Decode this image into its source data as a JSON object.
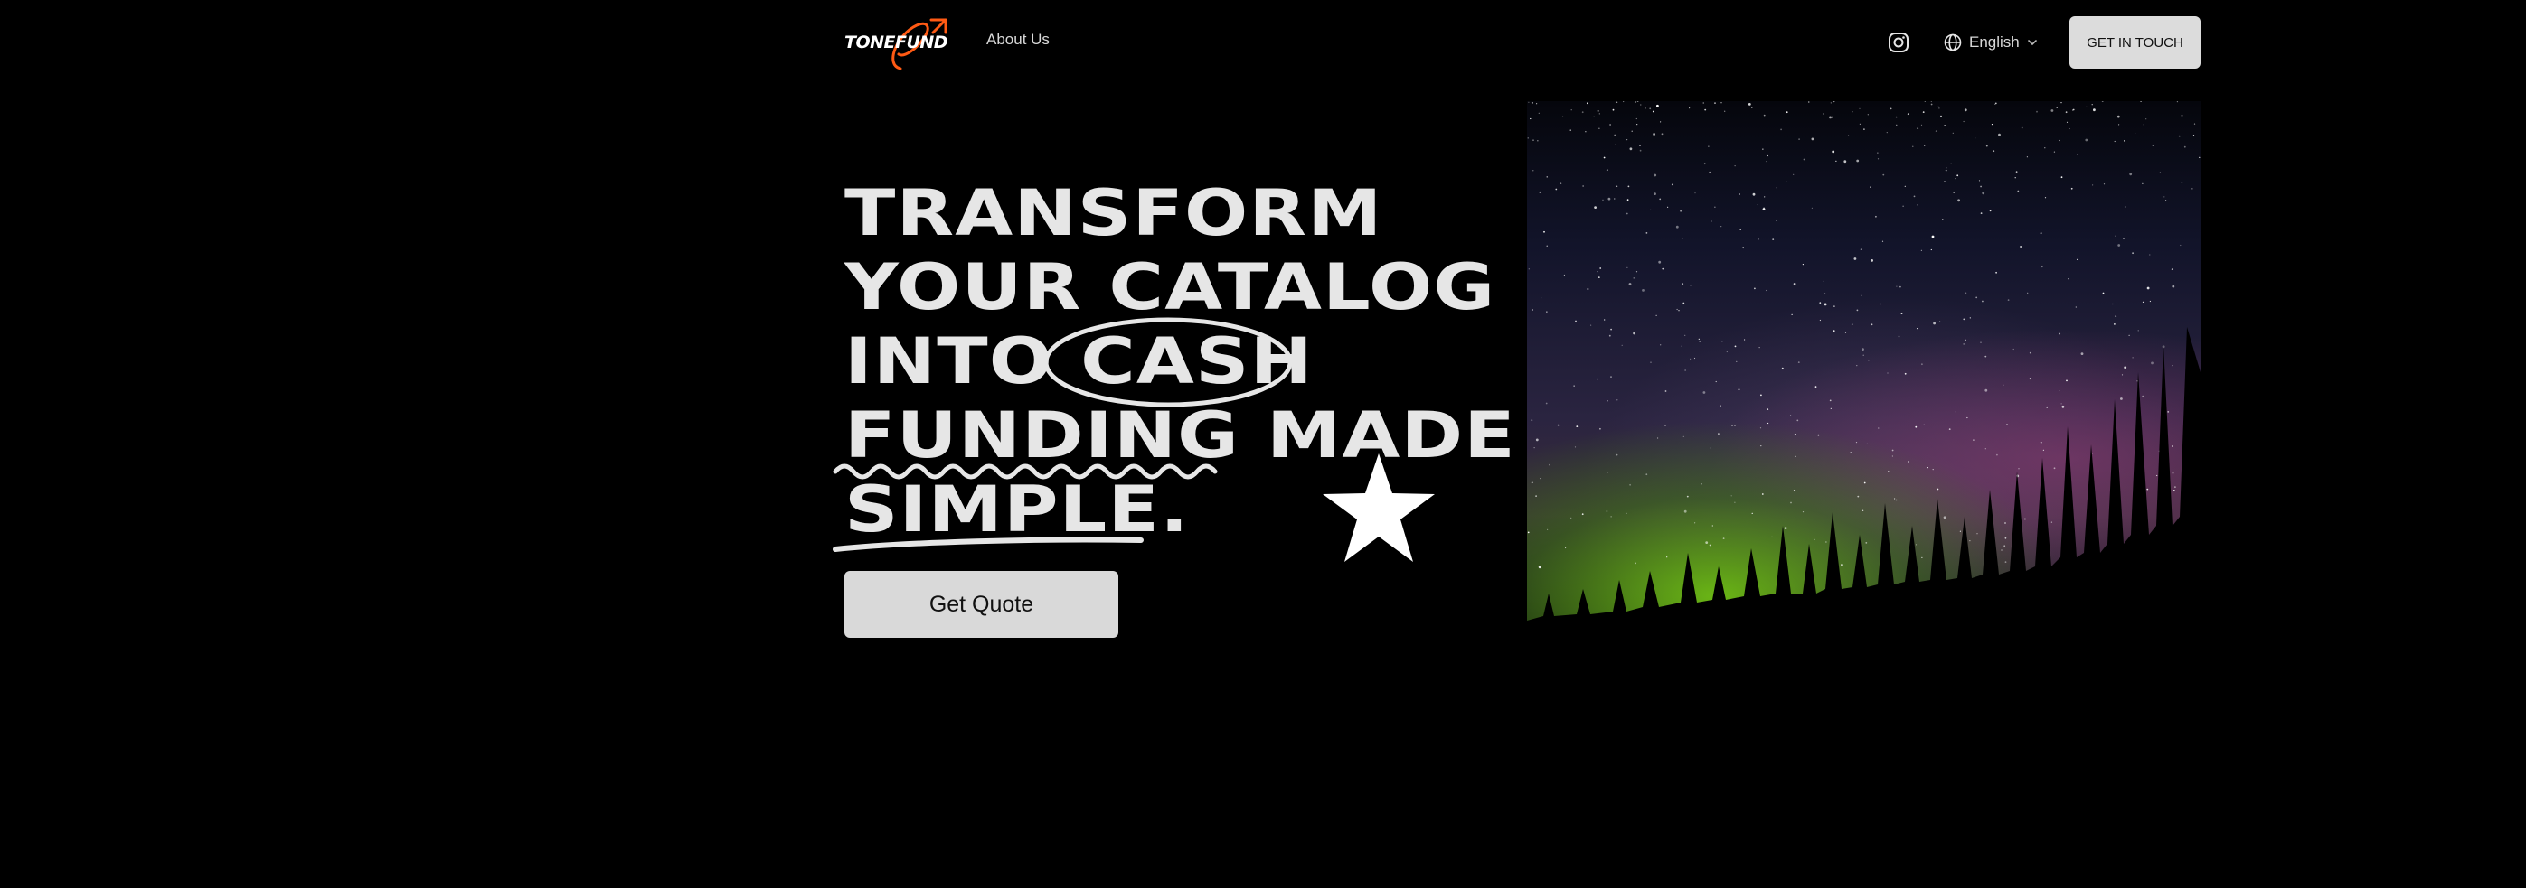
{
  "header": {
    "logo_text": "TONEFUND",
    "nav": {
      "about_label": "About Us"
    },
    "icons": {
      "social": "instagram-icon",
      "language": "globe-icon",
      "dropdown": "chevron-down-icon"
    },
    "language_label": "English",
    "cta_label": "GET IN TOUCH"
  },
  "hero": {
    "headline": {
      "line1": "TRANSFORM",
      "line2": "YOUR CATALOG",
      "line3_pre": "INTO",
      "line3_circled": "CASH",
      "line4_wavy": "FUNDING",
      "line4_post": "MADE",
      "line5_underlined": "SIMPLE",
      "line5_post": "."
    },
    "cta_label": "Get Quote",
    "decor_icon": "star-icon"
  },
  "image": {
    "subject": "night-sky-aurora-forest"
  },
  "colors": {
    "background": "#000000",
    "text": "#e6e6e6",
    "button_bg": "#d9d9d9",
    "button_text": "#111111",
    "logo_accent": "#ff5a14"
  }
}
